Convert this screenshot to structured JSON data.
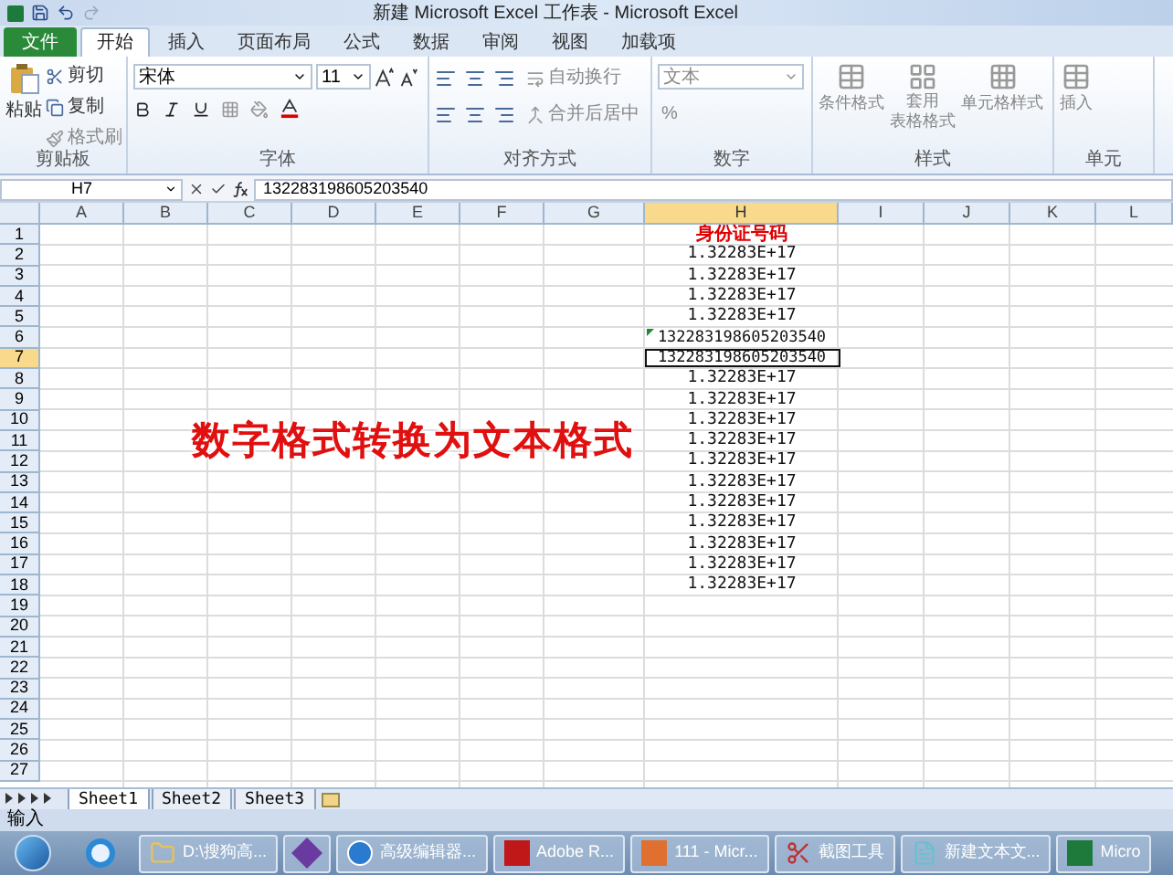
{
  "window": {
    "title": "新建 Microsoft Excel 工作表 - Microsoft Excel"
  },
  "tabs": [
    {
      "label": "文件",
      "kind": "file",
      "selected": false
    },
    {
      "label": "开始",
      "kind": "tab",
      "selected": true
    },
    {
      "label": "插入",
      "kind": "tab",
      "selected": false
    },
    {
      "label": "页面布局",
      "kind": "tab",
      "selected": false
    },
    {
      "label": "公式",
      "kind": "tab",
      "selected": false
    },
    {
      "label": "数据",
      "kind": "tab",
      "selected": false
    },
    {
      "label": "审阅",
      "kind": "tab",
      "selected": false
    },
    {
      "label": "视图",
      "kind": "tab",
      "selected": false
    },
    {
      "label": "加载项",
      "kind": "tab",
      "selected": false
    }
  ],
  "ribbon": {
    "clipboard": {
      "paste": "粘贴",
      "cut": "剪切",
      "copy": "复制",
      "format_painter": "格式刷",
      "label": "剪贴板"
    },
    "font": {
      "font_name": "宋体",
      "font_size": "11",
      "label": "字体"
    },
    "alignment": {
      "wrap": "自动换行",
      "merge": "合并后居中",
      "label": "对齐方式"
    },
    "number": {
      "format": "文本",
      "percent": "%",
      "label": "数字"
    },
    "styles": {
      "conditional": "条件格式",
      "table_line1": "套用",
      "table_line2": "表格格式",
      "cell_styles": "单元格样式",
      "label": "样式"
    },
    "cells": {
      "insert": "插入",
      "label": "单元"
    }
  },
  "formula_bar": {
    "name_box": "H7",
    "formula": "132283198605203540"
  },
  "columns": [
    {
      "label": "A",
      "selected": false
    },
    {
      "label": "B",
      "selected": false
    },
    {
      "label": "C",
      "selected": false
    },
    {
      "label": "D",
      "selected": false
    },
    {
      "label": "E",
      "selected": false
    },
    {
      "label": "F",
      "selected": false
    },
    {
      "label": "G",
      "selected": false
    },
    {
      "label": "H",
      "selected": true
    },
    {
      "label": "I",
      "selected": false
    },
    {
      "label": "J",
      "selected": false
    },
    {
      "label": "K",
      "selected": false
    },
    {
      "label": "L",
      "selected": false
    }
  ],
  "rows": [
    {
      "number": "1",
      "selected": false,
      "h": {
        "value": "身份证号码",
        "kind": "heading"
      }
    },
    {
      "number": "2",
      "selected": false,
      "h": {
        "value": "1.32283E+17",
        "kind": "number"
      }
    },
    {
      "number": "3",
      "selected": false,
      "h": {
        "value": "1.32283E+17",
        "kind": "number"
      }
    },
    {
      "number": "4",
      "selected": false,
      "h": {
        "value": "1.32283E+17",
        "kind": "number"
      }
    },
    {
      "number": "5",
      "selected": false,
      "h": {
        "value": "1.32283E+17",
        "kind": "number"
      }
    },
    {
      "number": "6",
      "selected": false,
      "h": {
        "value": "132283198605203540",
        "kind": "text",
        "error_flag": true
      }
    },
    {
      "number": "7",
      "selected": true,
      "h": {
        "value": "132283198605203540",
        "kind": "text",
        "error_flag": false
      }
    },
    {
      "number": "8",
      "selected": false,
      "h": {
        "value": "1.32283E+17",
        "kind": "number"
      }
    },
    {
      "number": "9",
      "selected": false,
      "h": {
        "value": "1.32283E+17",
        "kind": "number"
      }
    },
    {
      "number": "10",
      "selected": false,
      "h": {
        "value": "1.32283E+17",
        "kind": "number"
      }
    },
    {
      "number": "11",
      "selected": false,
      "h": {
        "value": "1.32283E+17",
        "kind": "number"
      }
    },
    {
      "number": "12",
      "selected": false,
      "h": {
        "value": "1.32283E+17",
        "kind": "number"
      }
    },
    {
      "number": "13",
      "selected": false,
      "h": {
        "value": "1.32283E+17",
        "kind": "number"
      }
    },
    {
      "number": "14",
      "selected": false,
      "h": {
        "value": "1.32283E+17",
        "kind": "number"
      }
    },
    {
      "number": "15",
      "selected": false,
      "h": {
        "value": "1.32283E+17",
        "kind": "number"
      }
    },
    {
      "number": "16",
      "selected": false,
      "h": {
        "value": "1.32283E+17",
        "kind": "number"
      }
    },
    {
      "number": "17",
      "selected": false,
      "h": {
        "value": "1.32283E+17",
        "kind": "number"
      }
    },
    {
      "number": "18",
      "selected": false,
      "h": {
        "value": "1.32283E+17",
        "kind": "number"
      }
    },
    {
      "number": "19",
      "selected": false
    },
    {
      "number": "20",
      "selected": false
    },
    {
      "number": "21",
      "selected": false
    },
    {
      "number": "22",
      "selected": false
    },
    {
      "number": "23",
      "selected": false
    },
    {
      "number": "24",
      "selected": false
    },
    {
      "number": "25",
      "selected": false
    },
    {
      "number": "26",
      "selected": false
    },
    {
      "number": "27",
      "selected": false
    }
  ],
  "caption": "数字格式转换为文本格式",
  "sheet_tabs": [
    {
      "label": "Sheet1",
      "selected": true
    },
    {
      "label": "Sheet2",
      "selected": false
    },
    {
      "label": "Sheet3",
      "selected": false
    }
  ],
  "status_bar": {
    "mode": "输入"
  },
  "taskbar": [
    {
      "kind": "folder",
      "label": "D:\\搜狗高..."
    },
    {
      "kind": "vs"
    },
    {
      "kind": "sogou",
      "label": "高级编辑器..."
    },
    {
      "kind": "pdf",
      "label": "Adobe R..."
    },
    {
      "kind": "ppt",
      "label": "111 - Micr..."
    },
    {
      "kind": "snip",
      "label": "截图工具"
    },
    {
      "kind": "note",
      "label": "新建文本文..."
    },
    {
      "kind": "excel",
      "label": "Micro"
    }
  ]
}
